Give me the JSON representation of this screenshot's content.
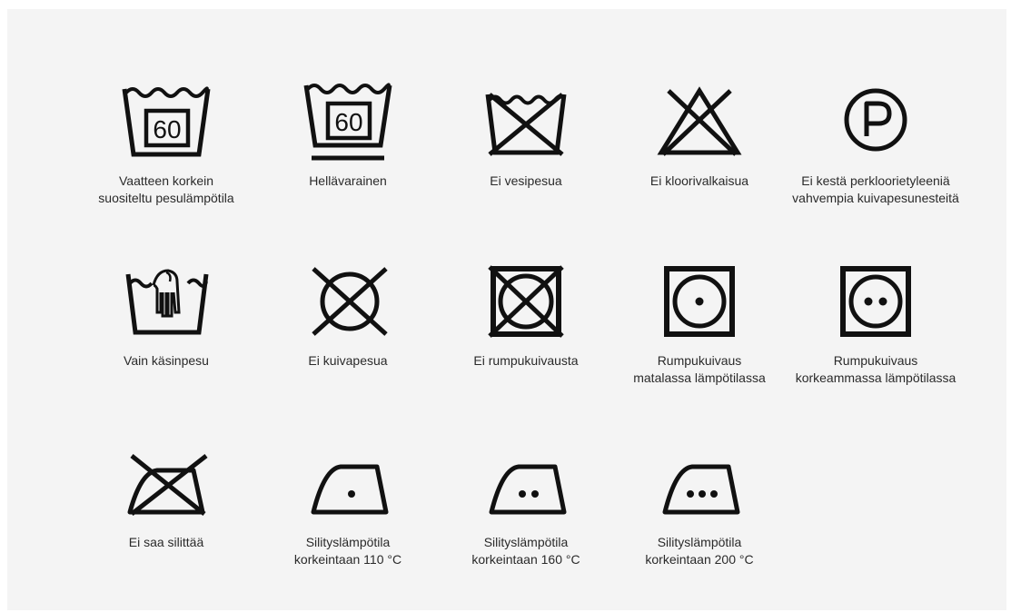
{
  "symbols": [
    {
      "label": "Vaatteen korkein\nsuositeltu pesulämpötila",
      "icon": "wash-60-icon",
      "temp": "60"
    },
    {
      "label": "Hellävarainen",
      "icon": "wash-60-gentle-icon",
      "temp": "60"
    },
    {
      "label": "Ei vesipesua",
      "icon": "no-wash-icon"
    },
    {
      "label": "Ei kloorivalkaisua",
      "icon": "no-bleach-icon"
    },
    {
      "label": "Ei kestä perkloorietyleeniä\nvahvempia kuivapesunesteitä",
      "icon": "dry-clean-p-icon",
      "letter": "P"
    },
    {
      "label": "Vain käsinpesu",
      "icon": "hand-wash-icon"
    },
    {
      "label": "Ei kuivapesua",
      "icon": "no-dry-clean-icon"
    },
    {
      "label": "Ei rumpukuivausta",
      "icon": "no-tumble-dry-icon"
    },
    {
      "label": "Rumpukuivaus\nmatalassa lämpötilassa",
      "icon": "tumble-dry-low-icon"
    },
    {
      "label": "Rumpukuivaus\nkorkeammassa lämpötilassa",
      "icon": "tumble-dry-high-icon"
    },
    {
      "label": "Ei saa silittää",
      "icon": "no-iron-icon"
    },
    {
      "label": "Silityslämpötila\nkorkeintaan 110 °C",
      "icon": "iron-one-dot-icon"
    },
    {
      "label": "Silityslämpötila\nkorkeintaan 160 °C",
      "icon": "iron-two-dots-icon"
    },
    {
      "label": "Silityslämpötila\nkorkeintaan 200 °C",
      "icon": "iron-three-dots-icon"
    }
  ],
  "colors": {
    "background": "#f4f4f4",
    "ink": "#111111",
    "text": "#2a2a2a"
  }
}
